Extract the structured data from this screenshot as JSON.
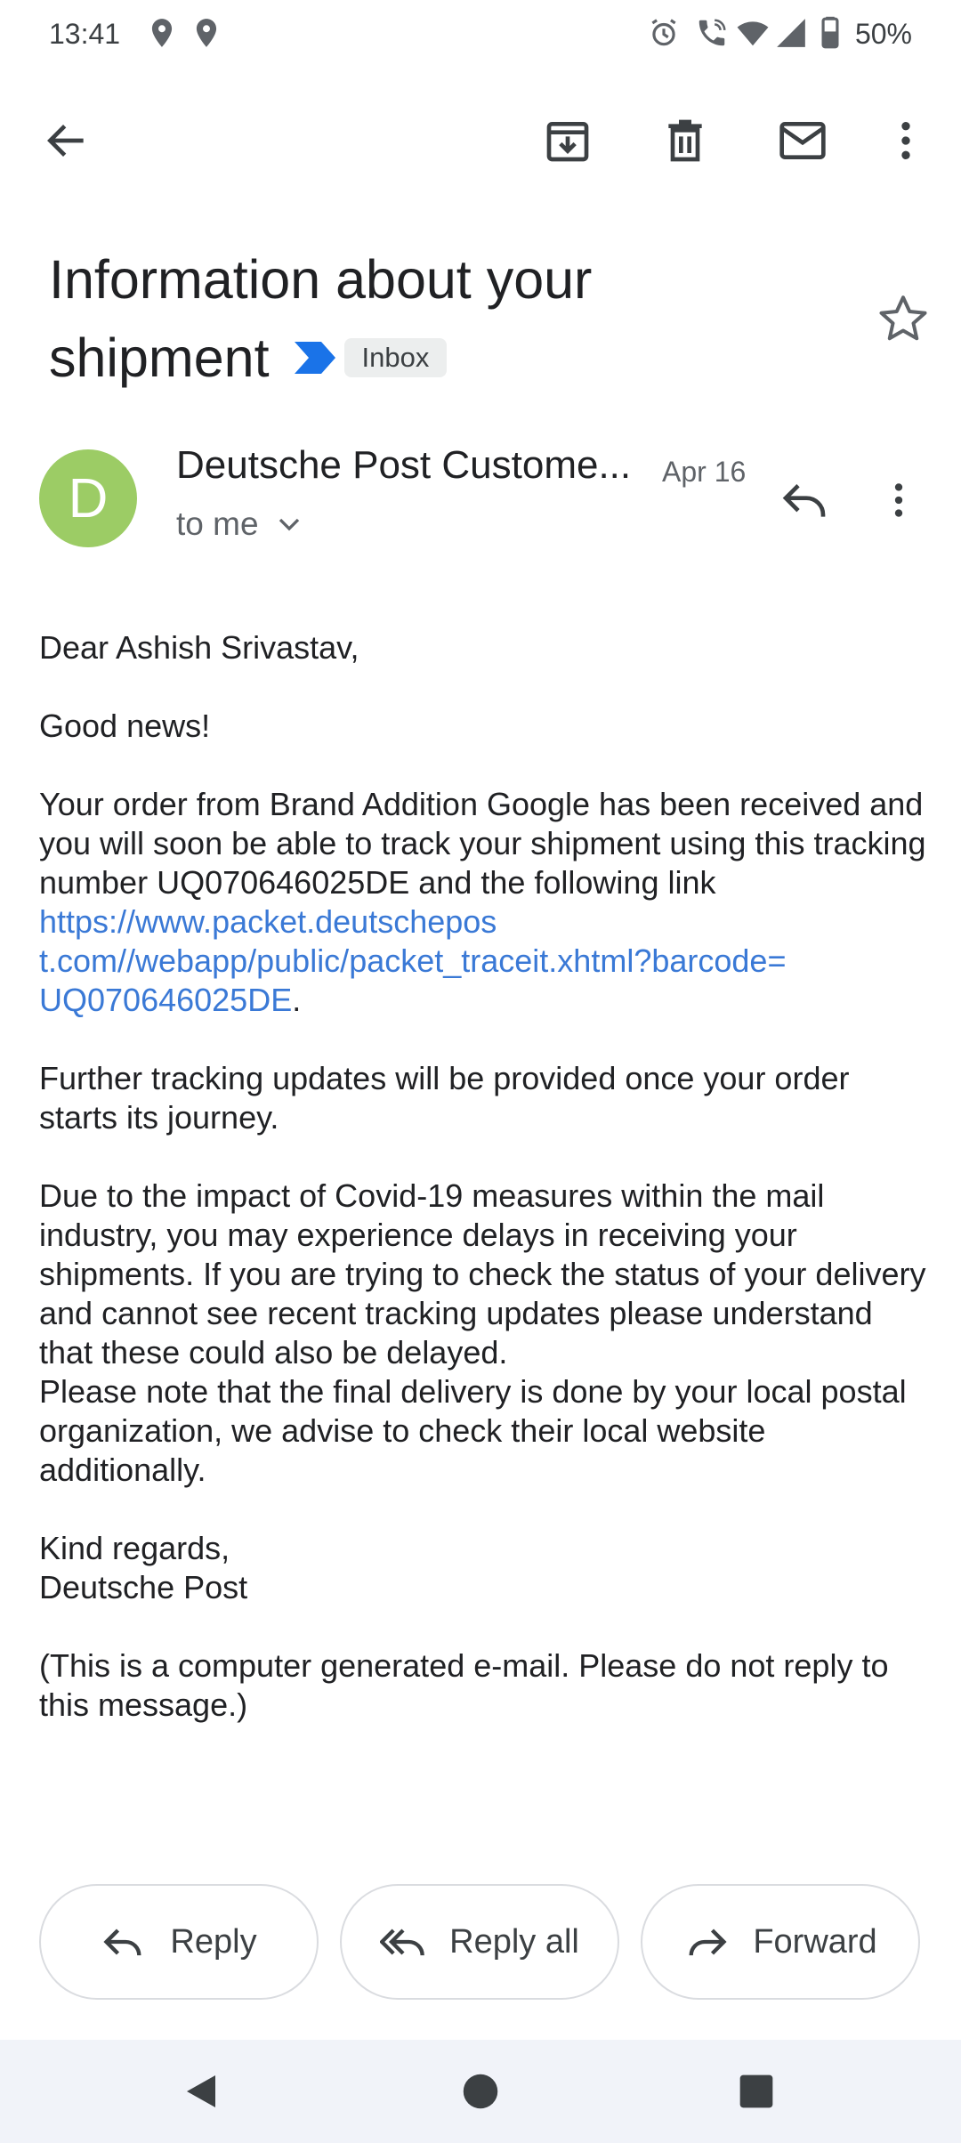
{
  "status_bar": {
    "time": "13:41",
    "battery_percent": "50%"
  },
  "subject": {
    "line1": "Information about your",
    "line2": "shipment",
    "label_chip": "Inbox"
  },
  "sender": {
    "avatar_letter": "D",
    "avatar_color": "#9ccc65",
    "name": "Deutsche Post Custome...",
    "date": "Apr 16",
    "to_text": "to me"
  },
  "body": {
    "greeting": "Dear Ashish Srivastav,",
    "good_news": "Good news!",
    "order_text": "Your order from Brand Addition Google has been received and you will soon be able to track your shipment using this tracking number UQ070646025DE and the following link ",
    "link_line1": "https://www.packet.deutschepos",
    "link_line2": "t.com//webapp/public/packet_traceit.xhtml?barcode=",
    "link_line3": "UQ070646025DE",
    "link_end": ".",
    "further": "Further tracking updates will be provided once your order starts its journey.",
    "covid": "Due to the impact of Covid-19 measures within the mail industry, you may experience delays in receiving your shipments. If you are trying to check the status of your delivery and cannot see recent tracking updates please understand that these could also be delayed.",
    "note": "Please note that the final delivery is done by your local postal organization, we advise to check their local website additionally.",
    "regards": "Kind regards,",
    "signature": "Deutsche Post",
    "disclaimer": "(This is a computer generated e-mail. Please do not reply to this message.)"
  },
  "actions": {
    "reply": "Reply",
    "reply_all": "Reply all",
    "forward": "Forward"
  },
  "colors": {
    "link": "#3a79d6",
    "importance": "#1a73e8"
  }
}
